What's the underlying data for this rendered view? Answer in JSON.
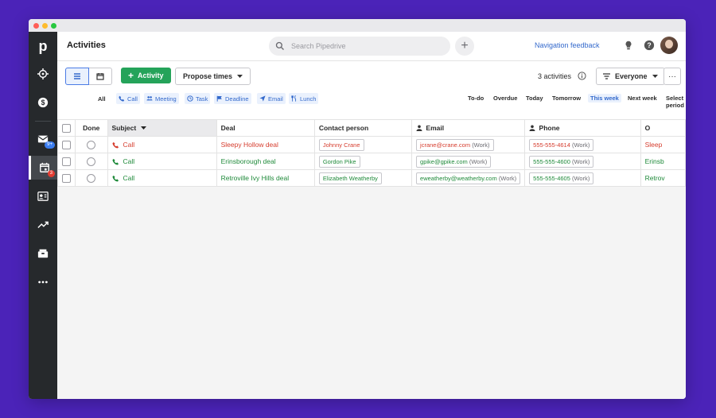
{
  "app": {
    "logo_letter": "p",
    "page_title": "Activities"
  },
  "search": {
    "placeholder": "Search Pipedrive"
  },
  "header": {
    "nav_feedback": "Navigation feedback"
  },
  "sidebar": {
    "items": [
      {
        "icon": "target-icon"
      },
      {
        "icon": "dollar-icon"
      },
      {
        "icon": "mail-icon",
        "badge": "9+"
      },
      {
        "icon": "calendar-icon",
        "badge": "3",
        "active": true
      },
      {
        "icon": "contacts-icon"
      },
      {
        "icon": "trend-icon"
      },
      {
        "icon": "product-icon"
      },
      {
        "icon": "more-icon"
      }
    ]
  },
  "toolbar": {
    "add_label": "Activity",
    "propose_label": "Propose times",
    "count_text": "3 activities",
    "owner_label": "Everyone",
    "more_label": "···"
  },
  "filters": {
    "all": "All",
    "types": [
      "Call",
      "Meeting",
      "Task",
      "Deadline",
      "Email",
      "Lunch"
    ],
    "periods": [
      "To-do",
      "Overdue",
      "Today",
      "Tomorrow",
      "This week",
      "Next week",
      "Select period"
    ],
    "active_period": "This week"
  },
  "table": {
    "columns": [
      "Done",
      "Subject",
      "Deal",
      "Contact person",
      "Email",
      "Phone",
      "O"
    ],
    "rows": [
      {
        "subject": "Call",
        "deal": "Sleepy Hollow deal",
        "contact": "Johnny Crane",
        "email": "jcrane@crane.com",
        "email_type": "(Work)",
        "phone": "555-555-4614",
        "phone_type": "(Work)",
        "extra": "Sleep",
        "status": "overdue"
      },
      {
        "subject": "Call",
        "deal": "Erinsborough deal",
        "contact": "Gordon Pike",
        "email": "gpike@gpike.com",
        "email_type": "(Work)",
        "phone": "555-555-4600",
        "phone_type": "(Work)",
        "extra": "Erinsb",
        "status": "upcoming"
      },
      {
        "subject": "Call",
        "deal": "Retroville Ivy Hills deal",
        "contact": "Elizabeth Weatherby",
        "email": "eweatherby@weatherby.com",
        "email_type": "(Work)",
        "phone": "555-555-4605",
        "phone_type": "(Work)",
        "extra": "Retrov",
        "status": "upcoming"
      }
    ]
  },
  "colors": {
    "accent": "#3369cc",
    "add_button": "#25a35a",
    "overdue": "#d63d2e",
    "upcoming": "#1f8a3a",
    "background": "#4b23b8"
  }
}
